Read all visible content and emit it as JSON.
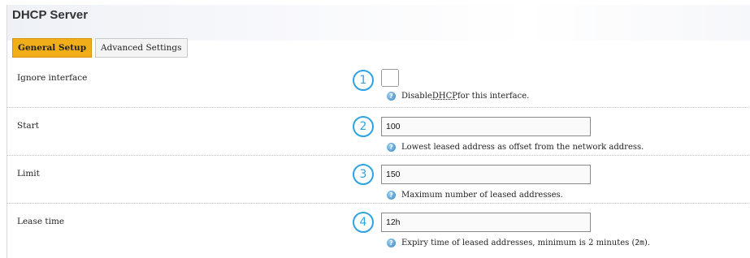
{
  "page": {
    "title": "DHCP Server"
  },
  "tabs": [
    {
      "label": "General Setup",
      "active": true
    },
    {
      "label": "Advanced Settings",
      "active": false
    }
  ],
  "fields": {
    "ignore": {
      "label": "Ignore interface",
      "badge": "1",
      "checked": false,
      "help_prefix": "Disable ",
      "help_abbr": "DHCP",
      "help_suffix": " for this interface."
    },
    "start": {
      "label": "Start",
      "badge": "2",
      "value": "100",
      "help": "Lowest leased address as offset from the network address."
    },
    "limit": {
      "label": "Limit",
      "badge": "3",
      "value": "150",
      "help": "Maximum number of leased addresses."
    },
    "leasetime": {
      "label": "Lease time",
      "badge": "4",
      "value": "12h",
      "help_prefix": "Expiry time of leased addresses, minimum is 2 minutes (",
      "help_code": "2m",
      "help_suffix": ")."
    }
  },
  "colors": {
    "accent": "#f2ae19",
    "badge": "#2ea3e3",
    "help_icon": "#3a86c4"
  },
  "icons": {
    "help": "help-icon",
    "badge": "numbered-circle"
  }
}
